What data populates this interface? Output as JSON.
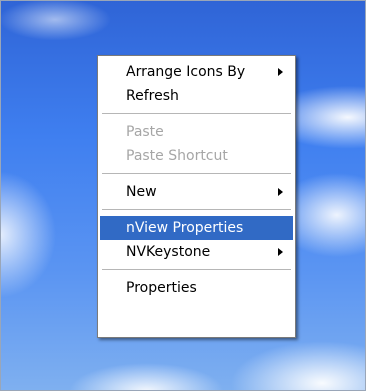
{
  "context_menu": {
    "items": [
      {
        "label": "Arrange Icons By",
        "submenu": true,
        "enabled": true
      },
      {
        "label": "Refresh",
        "submenu": false,
        "enabled": true
      },
      {
        "label": "Paste",
        "submenu": false,
        "enabled": false
      },
      {
        "label": "Paste Shortcut",
        "submenu": false,
        "enabled": false
      },
      {
        "label": "New",
        "submenu": true,
        "enabled": true
      },
      {
        "label": "nView Properties",
        "submenu": false,
        "enabled": true,
        "highlighted": true
      },
      {
        "label": "NVKeystone",
        "submenu": true,
        "enabled": true
      },
      {
        "label": "Properties",
        "submenu": false,
        "enabled": true
      }
    ],
    "highlight_color": "#316ac5"
  }
}
